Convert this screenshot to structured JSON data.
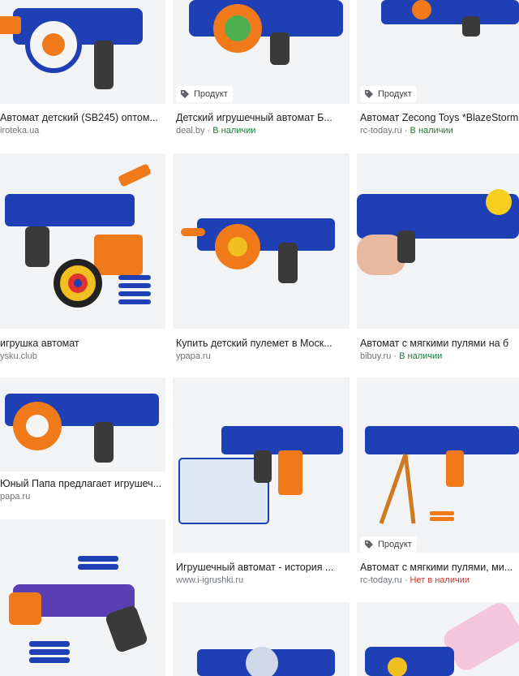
{
  "colors": {
    "thumb_bg": "#f1f3f4",
    "in_stock": "#188038",
    "out_of_stock": "#d93025",
    "blaster_blue": "#1f3fb5",
    "blaster_orange": "#f07a1a",
    "blaster_grey": "#3a3a3a"
  },
  "results": [
    {
      "title": "Автомат детский (SB245) оптом...",
      "source": "iroteka.ua",
      "badge": "",
      "availability": "",
      "status": "",
      "icon": "blaster-image"
    },
    {
      "title": "Детский игрушечный автомат Б...",
      "source": "deal.by",
      "badge": "Продукт",
      "availability": "В наличии",
      "status": "in",
      "icon": "blaster-image"
    },
    {
      "title": "Автомат Zecong Toys *BlazeStorm",
      "source": "rc-today.ru",
      "badge": "Продукт",
      "availability": "В наличии",
      "status": "in",
      "icon": "blaster-image"
    },
    {
      "title": "игрушка автомат",
      "source": "ysku.club",
      "badge": "",
      "availability": "",
      "status": "",
      "icon": "blaster-target-image"
    },
    {
      "title": "Купить детский пулемет в Моск...",
      "source": "урapa.ru",
      "badge": "",
      "availability": "",
      "status": "",
      "icon": "blaster-image"
    },
    {
      "title": "Автомат с мягкими пулями на б",
      "source": "bibuy.ru",
      "badge": "",
      "availability": "В наличии",
      "status": "in",
      "icon": "blaster-hand-image"
    },
    {
      "title": "Юный Папа предлагает игрушеч...",
      "source": "papa.ru",
      "badge": "",
      "availability": "",
      "status": "",
      "icon": "blaster-image"
    },
    {
      "title": "Игрушечный автомат - история ...",
      "source": "www.i-igrushki.ru",
      "badge": "",
      "availability": "",
      "status": "",
      "icon": "blaster-box-image"
    },
    {
      "title": "Автомат с мягкими пулями, ми...",
      "source": "rc-today.ru",
      "badge": "Продукт",
      "availability": "Нет в наличии",
      "status": "out",
      "icon": "blaster-tripod-image"
    },
    {
      "title": "",
      "source": "",
      "badge": "",
      "availability": "",
      "status": "",
      "icon": "shotgun-blaster-image"
    },
    {
      "title": "",
      "source": "",
      "badge": "",
      "availability": "",
      "status": "",
      "icon": "blaster-image"
    },
    {
      "title": "",
      "source": "",
      "badge": "",
      "availability": "",
      "status": "",
      "icon": "pink-blaster-image"
    }
  ]
}
